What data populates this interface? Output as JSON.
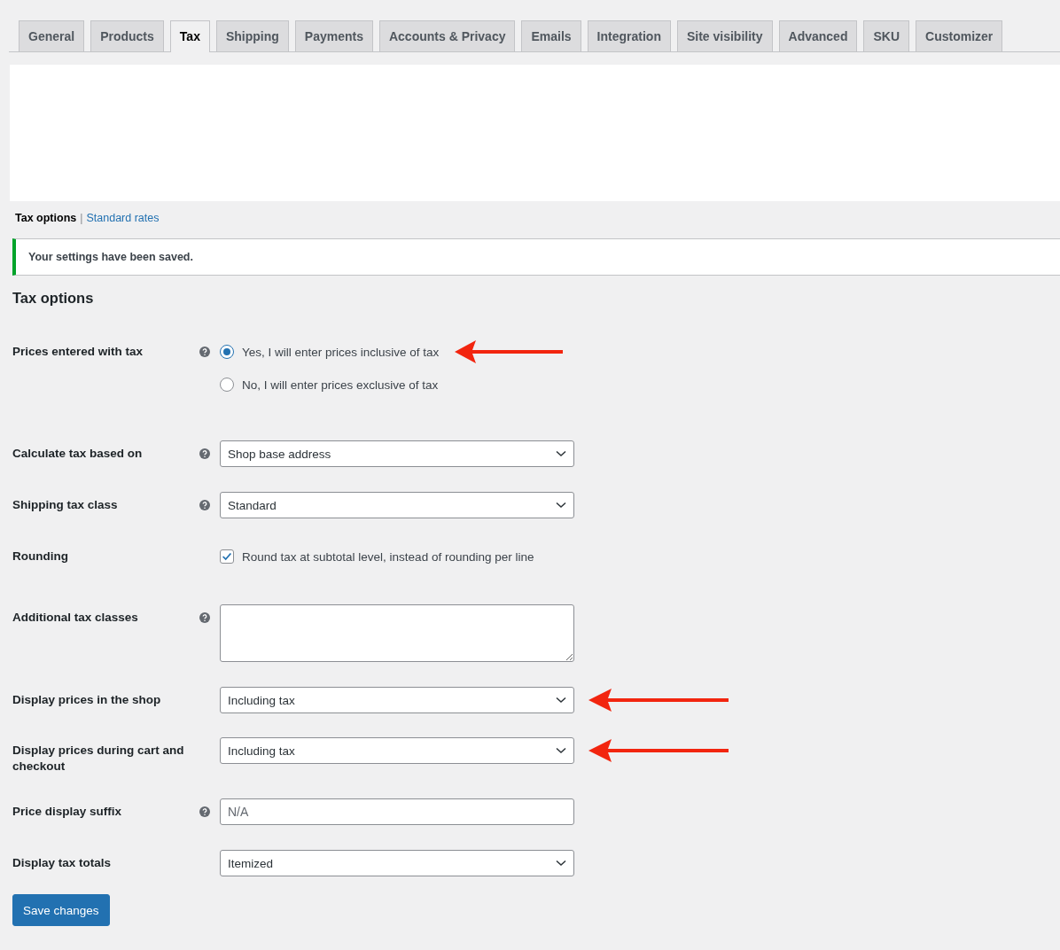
{
  "tabs": [
    {
      "label": "General",
      "selected": false
    },
    {
      "label": "Products",
      "selected": false
    },
    {
      "label": "Tax",
      "selected": true
    },
    {
      "label": "Shipping",
      "selected": false
    },
    {
      "label": "Payments",
      "selected": false
    },
    {
      "label": "Accounts & Privacy",
      "selected": false
    },
    {
      "label": "Emails",
      "selected": false
    },
    {
      "label": "Integration",
      "selected": false
    },
    {
      "label": "Site visibility",
      "selected": false
    },
    {
      "label": "Advanced",
      "selected": false
    },
    {
      "label": "SKU",
      "selected": false
    },
    {
      "label": "Customizer",
      "selected": false
    }
  ],
  "subnav": [
    {
      "label": "Tax options",
      "selected": true
    },
    {
      "label": "Standard rates",
      "selected": false
    }
  ],
  "subnav_separator": "|",
  "notice": {
    "text": "Your settings have been saved."
  },
  "heading": "Tax options",
  "settings": [
    {
      "kind": "radio",
      "label": "Prices entered with tax",
      "help": true,
      "options": [
        {
          "label": "Yes, I will enter prices inclusive of tax",
          "selected": true,
          "arrow": true
        },
        {
          "label": "No, I will enter prices exclusive of tax",
          "selected": false,
          "arrow": false
        }
      ]
    },
    {
      "kind": "select",
      "label": "Calculate tax based on",
      "help": true,
      "value": "Shop base address",
      "arrow": false
    },
    {
      "kind": "select",
      "label": "Shipping tax class",
      "help": true,
      "value": "Standard",
      "arrow": false
    },
    {
      "kind": "checkbox",
      "label": "Rounding",
      "help": false,
      "text": "Round tax at subtotal level, instead of rounding per line",
      "checked": true
    },
    {
      "kind": "textarea",
      "label": "Additional tax classes",
      "help": true
    },
    {
      "kind": "select",
      "label": "Display prices in the shop",
      "help": false,
      "value": "Including tax",
      "arrow": true
    },
    {
      "kind": "select",
      "label": "Display prices during cart and checkout",
      "help": false,
      "value": "Including tax",
      "arrow": true
    },
    {
      "kind": "text",
      "label": "Price display suffix",
      "help": true,
      "placeholder": "N/A"
    },
    {
      "kind": "select",
      "label": "Display tax totals",
      "help": false,
      "value": "Itemized",
      "arrow": false
    }
  ],
  "save_button": "Save changes"
}
